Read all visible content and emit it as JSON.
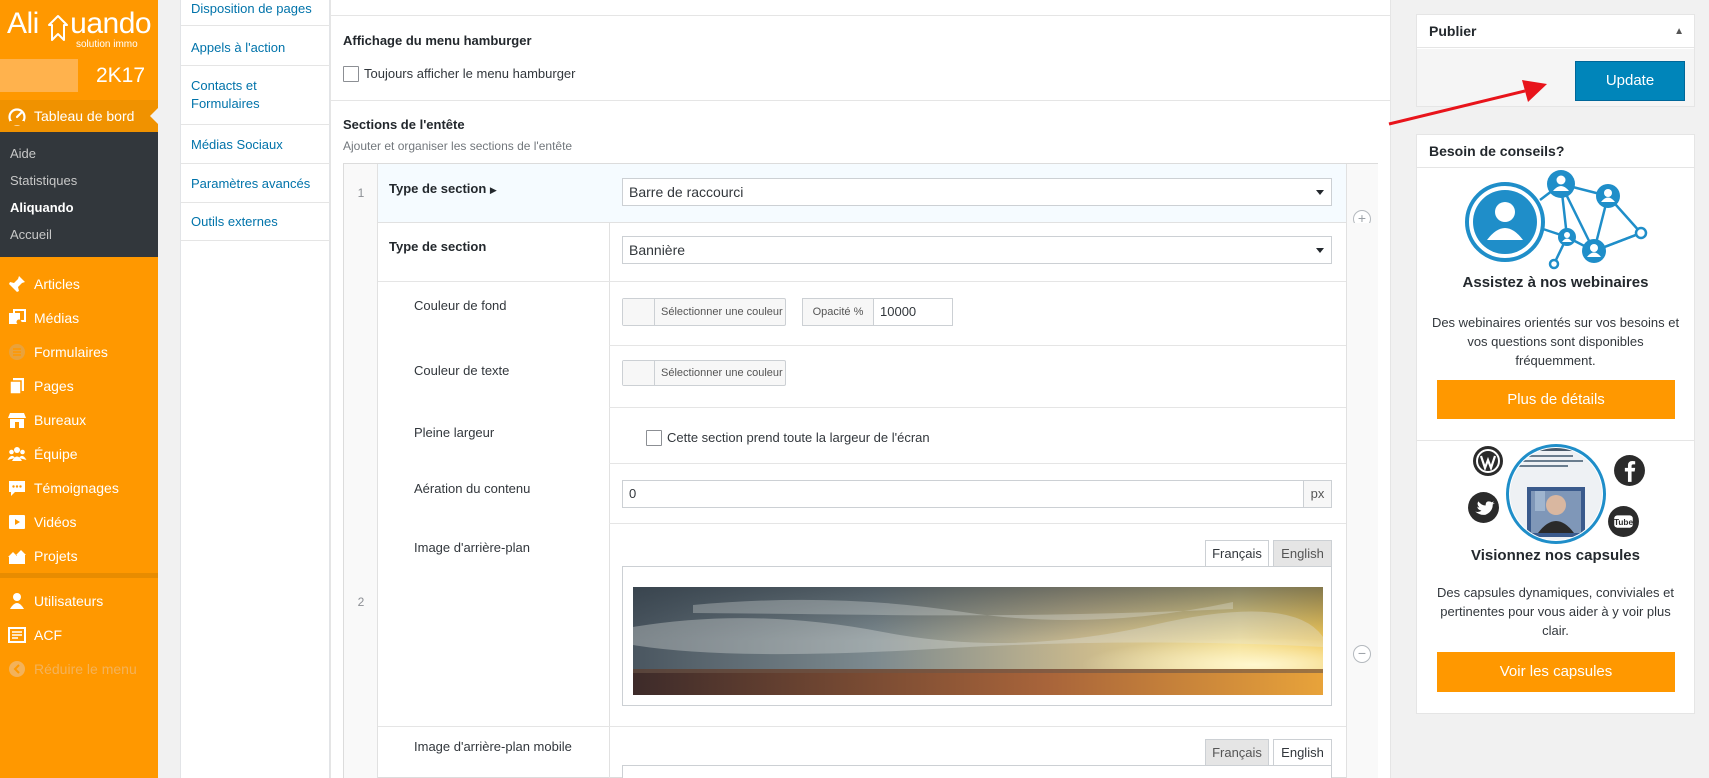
{
  "brand": {
    "logo_text": "Aliquando",
    "tagline": "solution immo",
    "version": "2K17"
  },
  "admin_menu": {
    "current": "Tableau de bord",
    "submenu": [
      "Aide",
      "Statistiques",
      "Aliquando",
      "Accueil"
    ],
    "items": [
      {
        "label": "Articles",
        "icon": "pin-icon"
      },
      {
        "label": "Médias",
        "icon": "media-icon"
      },
      {
        "label": "Formulaires",
        "icon": "forms-icon"
      },
      {
        "label": "Pages",
        "icon": "pages-icon"
      },
      {
        "label": "Bureaux",
        "icon": "store-icon"
      },
      {
        "label": "Équipe",
        "icon": "team-icon"
      },
      {
        "label": "Témoignages",
        "icon": "comment-icon"
      },
      {
        "label": "Vidéos",
        "icon": "video-icon"
      },
      {
        "label": "Projets",
        "icon": "building-icon"
      },
      {
        "label": "Utilisateurs",
        "icon": "user-icon"
      },
      {
        "label": "ACF",
        "icon": "acf-icon"
      }
    ],
    "collapse_label": "Réduire le menu"
  },
  "settings_nav": [
    "Disposition de pages",
    "Appels à l'action",
    "Contacts et Formulaires",
    "Médias Sociaux",
    "Paramètres avancés",
    "Outils externes"
  ],
  "hamburger": {
    "title": "Affichage du menu hamburger",
    "checkbox_label": "Toujours afficher le menu hamburger",
    "checked": false
  },
  "header_sections": {
    "title": "Sections de l'entête",
    "description": "Ajouter et organiser les sections de l'entête",
    "rows": [
      {
        "index": "1",
        "type_label": "Type de section",
        "type_value": "Barre de raccourci"
      },
      {
        "index": "2",
        "type_label": "Type de section",
        "type_value": "Bannière",
        "fields": {
          "bg_color_label": "Couleur de fond",
          "text_color_label": "Couleur de texte",
          "select_color": "Sélectionner une couleur",
          "opacity_label": "Opacité %",
          "opacity_value": "10000",
          "full_width_label": "Pleine largeur",
          "full_width_checkbox": "Cette section prend toute la largeur de l'écran",
          "padding_label": "Aération du contenu",
          "padding_value": "0",
          "padding_unit": "px",
          "bg_image_label": "Image d'arrière-plan",
          "bg_image_mobile_label": "Image d'arrière-plan mobile",
          "lang_fr": "Français",
          "lang_en": "English"
        }
      }
    ]
  },
  "publish": {
    "title": "Publier",
    "update_label": "Update"
  },
  "advice": {
    "title": "Besoin de conseils?",
    "webinar_title": "Assistez à nos webinaires",
    "webinar_text": "Des webinaires orientés sur vos besoins et vos questions sont disponibles fréquemment.",
    "webinar_button": "Plus de détails",
    "capsules_title": "Visionnez nos capsules",
    "capsules_text": "Des capsules dynamiques, conviviales et pertinentes pour vous aider à y voir plus clair.",
    "capsules_button": "Voir les capsules"
  },
  "colors": {
    "menu_orange": "#ff9800",
    "menu_dark": "#32373c",
    "wp_blue": "#0085ba",
    "link_blue": "#0073aa",
    "annotation_red": "#e8141b"
  }
}
